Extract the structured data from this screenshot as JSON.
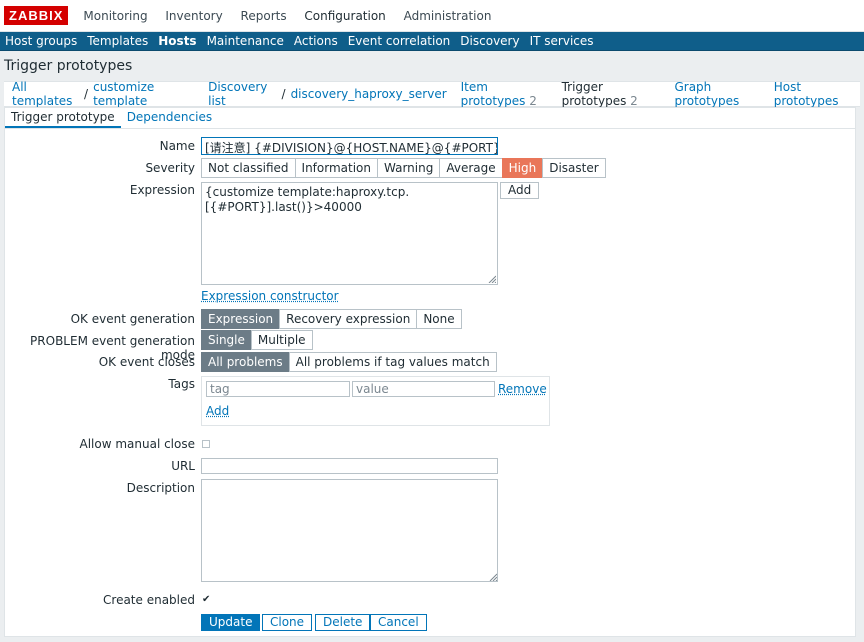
{
  "topnav": {
    "logo": "ZABBIX",
    "items": [
      "Monitoring",
      "Inventory",
      "Reports",
      "Configuration",
      "Administration"
    ],
    "active": "Configuration"
  },
  "subnav": {
    "items": [
      "Host groups",
      "Templates",
      "Hosts",
      "Maintenance",
      "Actions",
      "Event correlation",
      "Discovery",
      "IT services"
    ],
    "active": "Hosts"
  },
  "page_title": "Trigger prototypes",
  "breadcrumbs": {
    "all_templates": "All templates",
    "template": "customize template",
    "discovery_list": "Discovery list",
    "discovery_rule": "discovery_haproxy_server",
    "item_prototypes": "Item prototypes",
    "item_prototypes_count": "2",
    "trigger_prototypes": "Trigger prototypes",
    "trigger_prototypes_count": "2",
    "graph_prototypes": "Graph prototypes",
    "host_prototypes": "Host prototypes"
  },
  "tabs": {
    "trigger_prototype": "Trigger prototype",
    "dependencies": "Dependencies"
  },
  "form": {
    "name_label": "Name",
    "name_value": "[请注意] {#DIVISION}@{HOST.NAME}@{#PORT} TCP",
    "severity_label": "Severity",
    "severity_options": [
      "Not classified",
      "Information",
      "Warning",
      "Average",
      "High",
      "Disaster"
    ],
    "severity_selected": "High",
    "expression_label": "Expression",
    "expression_line1": "{customize template:haproxy.tcp.",
    "expression_line2": "[{#PORT}].last()}>40000",
    "expression_add": "Add",
    "expression_constructor": "Expression constructor",
    "ok_event_generation_label": "OK event generation",
    "ok_event_generation_options": [
      "Expression",
      "Recovery expression",
      "None"
    ],
    "ok_event_generation_selected": "Expression",
    "problem_mode_label": "PROBLEM event generation mode",
    "problem_mode_options": [
      "Single",
      "Multiple"
    ],
    "problem_mode_selected": "Single",
    "ok_event_closes_label": "OK event closes",
    "ok_event_closes_options": [
      "All problems",
      "All problems if tag values match"
    ],
    "ok_event_closes_selected": "All problems",
    "tags_label": "Tags",
    "tag_placeholder": "tag",
    "value_placeholder": "value",
    "tag_remove": "Remove",
    "tag_add": "Add",
    "allow_manual_close_label": "Allow manual close",
    "allow_manual_close_checked": false,
    "url_label": "URL",
    "url_value": "",
    "description_label": "Description",
    "description_value": "",
    "create_enabled_label": "Create enabled",
    "create_enabled_checked": true
  },
  "buttons": {
    "update": "Update",
    "clone": "Clone",
    "delete": "Delete",
    "cancel": "Cancel"
  }
}
